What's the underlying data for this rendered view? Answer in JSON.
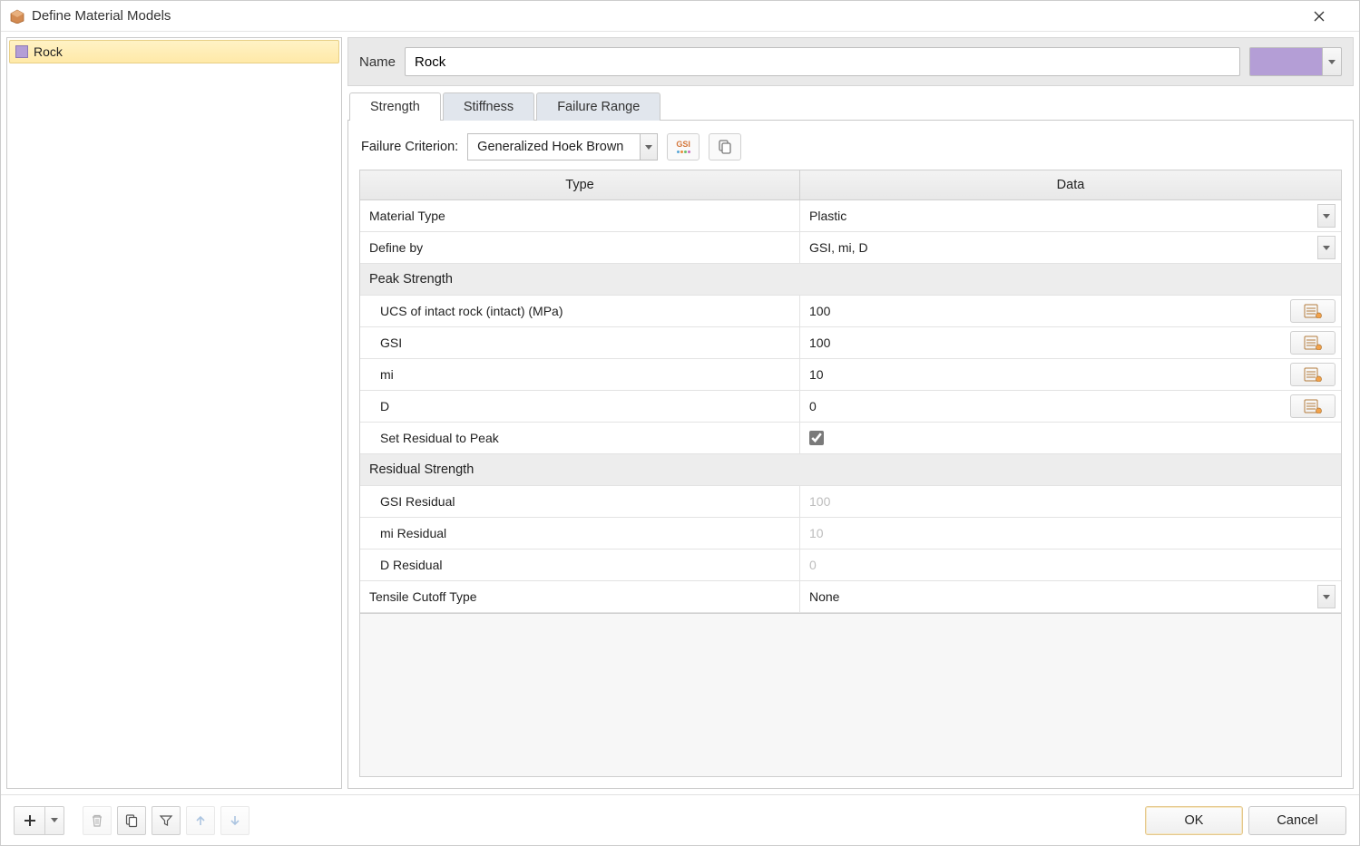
{
  "window": {
    "title": "Define Material Models"
  },
  "sidebar": {
    "items": [
      {
        "name": "Rock"
      }
    ]
  },
  "header": {
    "name_label": "Name",
    "name_value": "Rock",
    "color": "#b49ed6"
  },
  "tabs": [
    {
      "id": "strength",
      "label": "Strength",
      "active": true
    },
    {
      "id": "stiffness",
      "label": "Stiffness",
      "active": false
    },
    {
      "id": "failure_range",
      "label": "Failure Range",
      "active": false
    }
  ],
  "strength": {
    "criterion_label": "Failure Criterion:",
    "criterion_value": "Generalized Hoek Brown",
    "columns": {
      "type": "Type",
      "data": "Data"
    },
    "rows": {
      "material_type": {
        "label": "Material Type",
        "value": "Plastic",
        "kind": "select"
      },
      "define_by": {
        "label": "Define by",
        "value": "GSI, mi, D",
        "kind": "select"
      },
      "peak_header": {
        "label": "Peak Strength"
      },
      "ucs": {
        "label": "UCS of intact rock (intact) (MPa)",
        "value": "100",
        "kind": "listbtn"
      },
      "gsi": {
        "label": "GSI",
        "value": "100",
        "kind": "listbtn"
      },
      "mi": {
        "label": "mi",
        "value": "10",
        "kind": "listbtn"
      },
      "d": {
        "label": "D",
        "value": "0",
        "kind": "listbtn"
      },
      "resid_to_peak": {
        "label": "Set Residual to Peak",
        "checked": true,
        "kind": "check"
      },
      "resid_header": {
        "label": "Residual Strength"
      },
      "gsi_r": {
        "label": "GSI Residual",
        "value": "100",
        "kind": "readonly"
      },
      "mi_r": {
        "label": "mi Residual",
        "value": "10",
        "kind": "readonly"
      },
      "d_r": {
        "label": "D Residual",
        "value": "0",
        "kind": "readonly"
      },
      "tensile": {
        "label": "Tensile Cutoff Type",
        "value": "None",
        "kind": "select"
      }
    }
  },
  "footer": {
    "ok": "OK",
    "cancel": "Cancel"
  }
}
